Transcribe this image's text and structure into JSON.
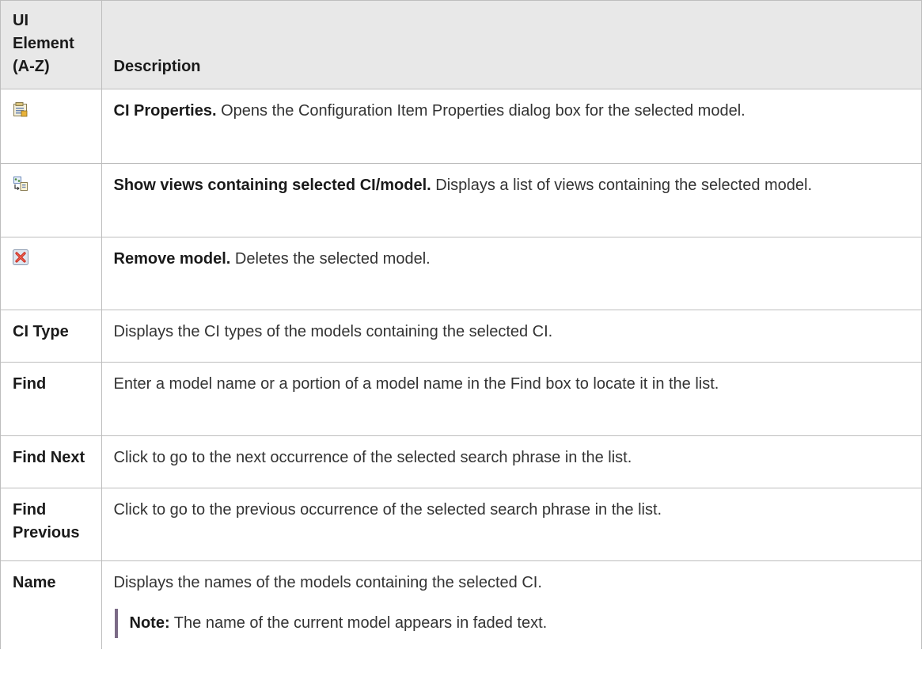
{
  "header": {
    "col1": "UI Element (A-Z)",
    "col2": "Description"
  },
  "rows": [
    {
      "icon": "ci-properties-icon",
      "title": "CI Properties.",
      "text": " Opens the Configuration Item Properties dialog box for the selected model."
    },
    {
      "icon": "show-views-icon",
      "title": "Show views containing selected CI/model.",
      "text": " Displays a list of views containing the selected model."
    },
    {
      "icon": "remove-model-icon",
      "title": "Remove model.",
      "text": " Deletes the selected model."
    },
    {
      "element": "CI Type",
      "text": "Displays the CI types of the models containing the selected CI."
    },
    {
      "element": "Find",
      "text": "Enter a model name or a portion of a model name in the Find box to locate it in the list."
    },
    {
      "element": "Find Next",
      "text": "Click to go to the next occurrence of the selected search phrase in the list."
    },
    {
      "element": "Find Previous",
      "text": "Click to go to the previous occurrence of the selected search phrase in the list."
    },
    {
      "element": "Name",
      "text": "Displays the names of the models containing the selected CI.",
      "note_label": "Note:",
      "note_text": " The name of the current model appears in faded text."
    }
  ],
  "colors": {
    "header_bg": "#e8e8e8",
    "border": "#bdbdbd",
    "note_bar": "#7b6a86"
  }
}
